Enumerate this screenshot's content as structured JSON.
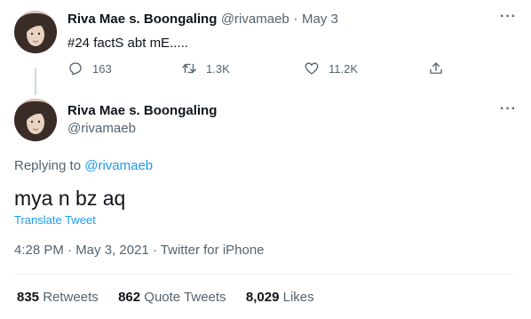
{
  "parent_tweet": {
    "display_name": "Riva Mae s. Boongaling",
    "handle": "@rivamaeb",
    "separator": "·",
    "date": "May 3",
    "text": "#24 factS abt mE.....",
    "more_icon": "more-dots-icon",
    "actions": {
      "replies": "163",
      "retweets": "1.3K",
      "likes": "11.2K"
    }
  },
  "main_tweet": {
    "display_name": "Riva Mae s. Boongaling",
    "handle": "@rivamaeb",
    "replying_prefix": "Replying to",
    "replying_handle": "@rivamaeb",
    "text": "mya n bz aq",
    "translate": "Translate Tweet",
    "timestamp": "4:28 PM · May 3, 2021 · Twitter for iPhone",
    "stats": {
      "retweets_count": "835",
      "retweets_label": "Retweets",
      "quotes_count": "862",
      "quotes_label": "Quote Tweets",
      "likes_count": "8,029",
      "likes_label": "Likes"
    }
  },
  "colors": {
    "accent": "#1d9bf0",
    "secondary_text": "#536471",
    "primary_text": "#0f1419"
  }
}
